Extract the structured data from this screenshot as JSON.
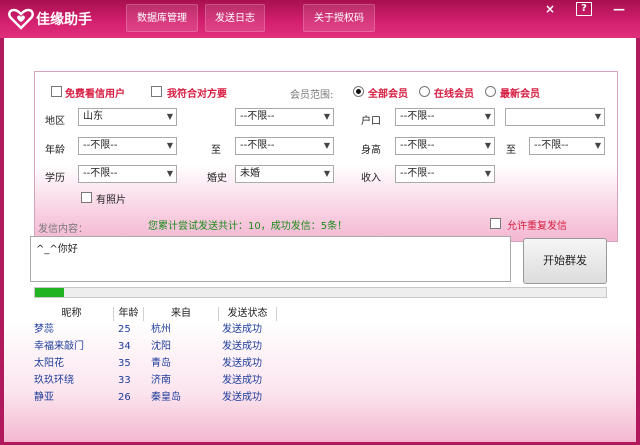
{
  "app": {
    "title": "佳缘助手",
    "nav": [
      "数据库管理",
      "发送日志",
      "关于授权码"
    ],
    "window_controls": {
      "close": "×",
      "help": "?",
      "minimize": "—"
    }
  },
  "filters": {
    "free_users_label": "免费看信用户",
    "match_me_label": "我符合对方要",
    "member_range_label": "会员范围:",
    "member_options": [
      "全部会员",
      "在线会员",
      "最新会员"
    ],
    "selected_member_option": "全部会员",
    "region_label": "地区",
    "region_value": "山东",
    "region_sub_value": "--不限--",
    "hukou_label": "户口",
    "hukou_value": "--不限--",
    "hukou_sub_value": "",
    "age_label": "年龄",
    "age_from": "--不限--",
    "to_label": "至",
    "age_to": "--不限--",
    "height_label": "身高",
    "height_from": "--不限--",
    "height_to": "--不限--",
    "edu_label": "学历",
    "edu_value": "--不限--",
    "marriage_label": "婚史",
    "marriage_value": "未婚",
    "income_label": "收入",
    "income_value": "--不限--",
    "photo_label": "有照片"
  },
  "sending": {
    "content_label": "发信内容：",
    "stats_text": "您累计尝试发送共计：10，成功发信：5条！",
    "allow_repeat_label": "允许重复发信",
    "message": "^_^你好",
    "start_button": "开始群发",
    "progress": 0.05
  },
  "table": {
    "headers": [
      "昵称",
      "年龄",
      "来自",
      "发送状态"
    ],
    "rows": [
      [
        "梦蕊",
        "25",
        "杭州",
        "发送成功"
      ],
      [
        "幸福来敲门",
        "34",
        "沈阳",
        "发送成功"
      ],
      [
        "太阳花",
        "35",
        "青岛",
        "发送成功"
      ],
      [
        "玖玖环绕",
        "33",
        "济南",
        "发送成功"
      ],
      [
        "静亚",
        "26",
        "秦皇岛",
        "发送成功"
      ]
    ]
  },
  "colors": {
    "brand": "#d21e6e",
    "accent_red": "#d61c40",
    "success_green": "#22b322",
    "link_blue": "#1d3d9a"
  },
  "icons": {
    "logo": "heart-logo-icon",
    "dropdown": "chevron-down-icon"
  }
}
